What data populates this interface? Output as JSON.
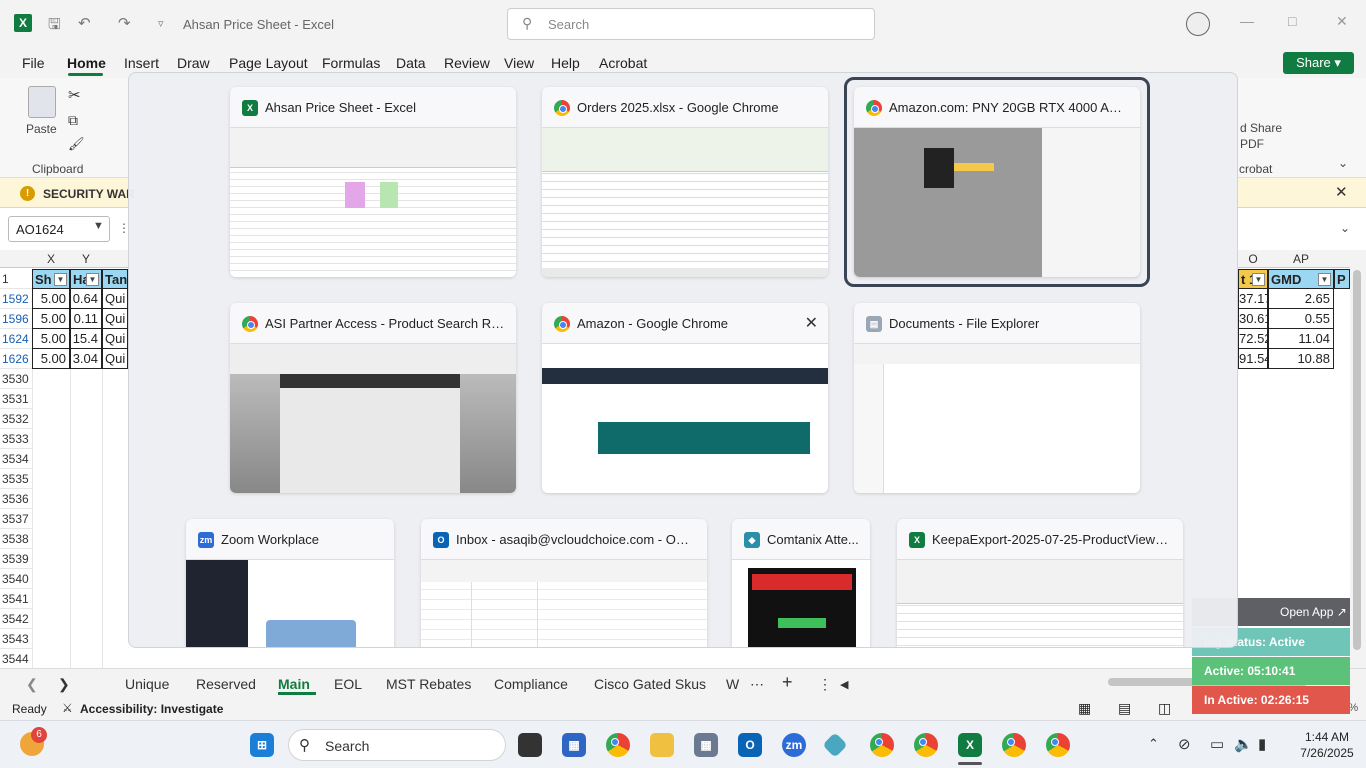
{
  "titlebar": {
    "doc_title": "Ahsan Price Sheet  -  Excel",
    "search_placeholder": "Search"
  },
  "ribbon_tabs": [
    "File",
    "Home",
    "Insert",
    "Draw",
    "Page Layout",
    "Formulas",
    "Data",
    "Review",
    "View",
    "Help",
    "Acrobat"
  ],
  "share_label": "Share",
  "ribbon": {
    "paste": "Paste",
    "clipboard": "Clipboard",
    "acrobat_share_line1": "d Share",
    "acrobat_share_line2": "PDF",
    "acrobat_group": "crobat"
  },
  "security_text": "SECURITY WAR",
  "namebox": "AO1624",
  "columns": {
    "left": [
      "X",
      "Y"
    ],
    "right": [
      "O",
      "AP"
    ]
  },
  "header_row": {
    "row_num": "1",
    "c1": "Sh",
    "c2": "Ha",
    "c3": "Tan",
    "r1": "t 1",
    "r2": "GMD",
    "r3": "P"
  },
  "rows": [
    {
      "num": "1592",
      "c1": "5.00",
      "c2": "0.64",
      "c3": "Qui",
      "r1": "37.17",
      "r2": "2.65"
    },
    {
      "num": "1596",
      "c1": "5.00",
      "c2": "0.11",
      "c3": "Qui",
      "r1": "30.61",
      "r2": "0.55"
    },
    {
      "num": "1624",
      "c1": "5.00",
      "c2": "15.4",
      "c3": "Qui",
      "r1": "72.52",
      "r2": "11.04"
    },
    {
      "num": "1626",
      "c1": "5.00",
      "c2": "3.04",
      "c3": "Qui",
      "r1": "91.54",
      "r2": "10.88"
    }
  ],
  "empty_rows": [
    "3530",
    "3531",
    "3532",
    "3533",
    "3534",
    "3535",
    "3536",
    "3537",
    "3538",
    "3539",
    "3540",
    "3541",
    "3542",
    "3543",
    "3544"
  ],
  "sheet_tabs": [
    "Unique",
    "Reserved",
    "Main",
    "EOL",
    "MST Rebates",
    "Compliance",
    "Cisco Gated Skus",
    "W"
  ],
  "status": {
    "ready": "Ready",
    "accessibility": "Accessibility: Investigate",
    "zoom": "100%"
  },
  "switcher": {
    "windows": [
      {
        "title": "Ahsan Price Sheet - Excel",
        "app": "excel"
      },
      {
        "title": "Orders 2025.xlsx - Google Chrome",
        "app": "chrome"
      },
      {
        "title": "Amazon.com: PNY 20GB RTX 4000 Ada 4x...",
        "app": "chrome"
      },
      {
        "title": "ASI Partner Access - Product Search Result...",
        "app": "chrome"
      },
      {
        "title": "Amazon - Google Chrome",
        "app": "chrome"
      },
      {
        "title": "Documents - File Explorer",
        "app": "explorer"
      },
      {
        "title": "Zoom Workplace",
        "app": "zoom"
      },
      {
        "title": "Inbox - asaqib@vcloudchoice.com - Outlo...",
        "app": "outlook"
      },
      {
        "title": "Comtanix Atte...",
        "app": "comtanix"
      },
      {
        "title": "KeepaExport-2025-07-25-ProductViewer -...",
        "app": "excel"
      }
    ]
  },
  "comtanix_widget": {
    "open_app": "Open App",
    "status": "ing Status: Active",
    "active": "Active: 05:10:41",
    "inactive": "In Active: 02:26:15"
  },
  "taskbar": {
    "search_placeholder": "Search",
    "badge_count": "6",
    "time": "1:44 AM",
    "date": "7/26/2025"
  },
  "colors": {
    "excel_green": "#107c41",
    "header_fill": "#9bd7f2",
    "widget_teal": "#6ec5b8",
    "widget_green": "#5cc27a",
    "widget_red": "#e2574c"
  }
}
